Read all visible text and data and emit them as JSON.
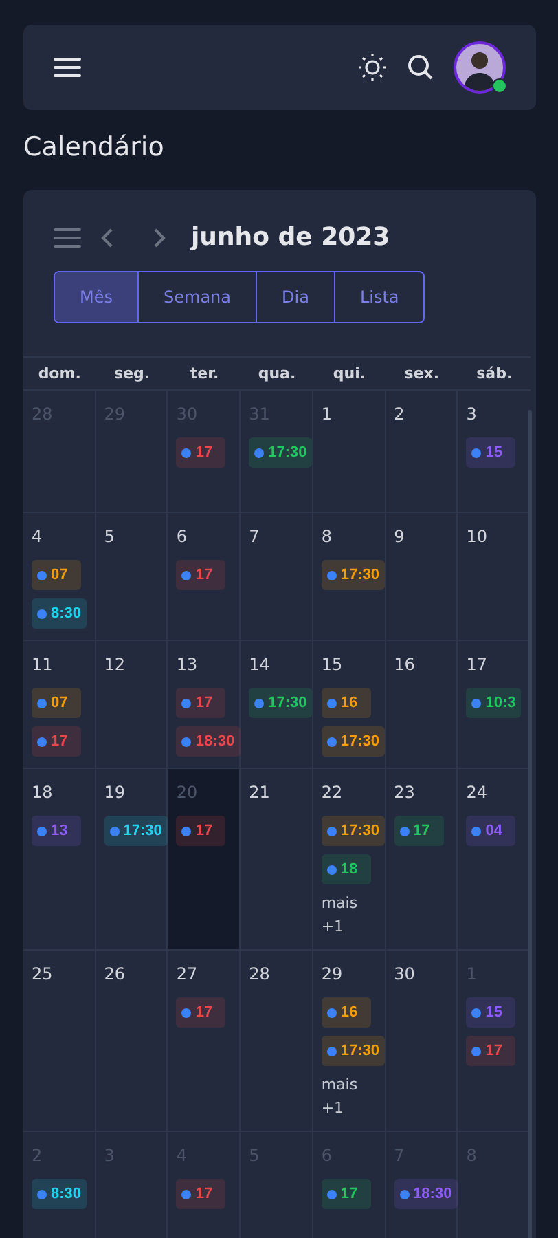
{
  "header": {
    "avatar": {
      "online": true
    }
  },
  "page_title": "Calendário",
  "calendar": {
    "title": "junho de 2023",
    "views": [
      {
        "label": "Mês",
        "selected": true
      },
      {
        "label": "Semana",
        "selected": false
      },
      {
        "label": "Dia",
        "selected": false
      },
      {
        "label": "Lista",
        "selected": false
      }
    ],
    "weekdays": [
      "dom.",
      "seg.",
      "ter.",
      "qua.",
      "qui.",
      "sex.",
      "sáb."
    ],
    "weeks": [
      {
        "days": [
          {
            "date": "28",
            "outside": true,
            "today": false
          },
          {
            "date": "29",
            "outside": true,
            "today": false
          },
          {
            "date": "30",
            "outside": true,
            "today": false,
            "events": [
              {
                "time": "17",
                "color": "#e5484d"
              }
            ]
          },
          {
            "date": "31",
            "outside": true,
            "today": false,
            "events": [
              {
                "time": "17:30",
                "color": "#22c55e"
              }
            ]
          },
          {
            "date": "1",
            "outside": false,
            "today": false
          },
          {
            "date": "2",
            "outside": false,
            "today": false
          },
          {
            "date": "3",
            "outside": false,
            "today": false,
            "events": [
              {
                "time": "15",
                "color": "#8b5cf6"
              }
            ]
          }
        ]
      },
      {
        "days": [
          {
            "date": "4",
            "outside": false,
            "today": false,
            "events": [
              {
                "time": "07",
                "color": "#f59e0b"
              },
              {
                "time": "8:30",
                "color": "#22d3ee"
              }
            ]
          },
          {
            "date": "5",
            "outside": false,
            "today": false
          },
          {
            "date": "6",
            "outside": false,
            "today": false,
            "events": [
              {
                "time": "17",
                "color": "#e5484d"
              }
            ]
          },
          {
            "date": "7",
            "outside": false,
            "today": false
          },
          {
            "date": "8",
            "outside": false,
            "today": false,
            "events": [
              {
                "time": "17:30",
                "color": "#f59e0b"
              }
            ]
          },
          {
            "date": "9",
            "outside": false,
            "today": false
          },
          {
            "date": "10",
            "outside": false,
            "today": false
          }
        ]
      },
      {
        "days": [
          {
            "date": "11",
            "outside": false,
            "today": false,
            "events": [
              {
                "time": "07",
                "color": "#f59e0b"
              },
              {
                "time": "17",
                "color": "#e5484d"
              }
            ]
          },
          {
            "date": "12",
            "outside": false,
            "today": false
          },
          {
            "date": "13",
            "outside": false,
            "today": false,
            "events": [
              {
                "time": "17",
                "color": "#e5484d"
              },
              {
                "time": "18:30",
                "color": "#e5484d"
              }
            ]
          },
          {
            "date": "14",
            "outside": false,
            "today": false,
            "events": [
              {
                "time": "17:30",
                "color": "#22c55e"
              }
            ]
          },
          {
            "date": "15",
            "outside": false,
            "today": false,
            "events": [
              {
                "time": "16",
                "color": "#f59e0b"
              },
              {
                "time": "17:30",
                "color": "#f59e0b"
              }
            ]
          },
          {
            "date": "16",
            "outside": false,
            "today": false
          },
          {
            "date": "17",
            "outside": false,
            "today": false,
            "events": [
              {
                "time": "10:3",
                "color": "#22c55e"
              }
            ]
          }
        ]
      },
      {
        "days": [
          {
            "date": "18",
            "outside": false,
            "today": false,
            "events": [
              {
                "time": "13",
                "color": "#8b5cf6"
              }
            ]
          },
          {
            "date": "19",
            "outside": false,
            "today": false,
            "events": [
              {
                "time": "17:30",
                "color": "#22d3ee"
              }
            ]
          },
          {
            "date": "20",
            "outside": false,
            "today": true,
            "events": [
              {
                "time": "17",
                "color": "#e5484d"
              }
            ]
          },
          {
            "date": "21",
            "outside": false,
            "today": false
          },
          {
            "date": "22",
            "outside": false,
            "today": false,
            "events": [
              {
                "time": "17:30",
                "color": "#f59e0b"
              },
              {
                "time": "18",
                "color": "#22c55e"
              }
            ],
            "more": "mais +1"
          },
          {
            "date": "23",
            "outside": false,
            "today": false,
            "events": [
              {
                "time": "17",
                "color": "#22c55e"
              }
            ]
          },
          {
            "date": "24",
            "outside": false,
            "today": false,
            "events": [
              {
                "time": "04",
                "color": "#8b5cf6"
              }
            ]
          }
        ]
      },
      {
        "days": [
          {
            "date": "25",
            "outside": false,
            "today": false
          },
          {
            "date": "26",
            "outside": false,
            "today": false
          },
          {
            "date": "27",
            "outside": false,
            "today": false,
            "events": [
              {
                "time": "17",
                "color": "#e5484d"
              }
            ]
          },
          {
            "date": "28",
            "outside": false,
            "today": false
          },
          {
            "date": "29",
            "outside": false,
            "today": false,
            "events": [
              {
                "time": "16",
                "color": "#f59e0b"
              },
              {
                "time": "17:30",
                "color": "#f59e0b"
              }
            ],
            "more": "mais +1"
          },
          {
            "date": "30",
            "outside": false,
            "today": false
          },
          {
            "date": "1",
            "outside": true,
            "today": false,
            "events": [
              {
                "time": "15",
                "color": "#8b5cf6"
              },
              {
                "time": "17",
                "color": "#e5484d"
              }
            ]
          }
        ]
      },
      {
        "days": [
          {
            "date": "2",
            "outside": true,
            "today": false,
            "events": [
              {
                "time": "8:30",
                "color": "#22d3ee"
              }
            ]
          },
          {
            "date": "3",
            "outside": true,
            "today": false
          },
          {
            "date": "4",
            "outside": true,
            "today": false,
            "events": [
              {
                "time": "17",
                "color": "#e5484d"
              }
            ]
          },
          {
            "date": "5",
            "outside": true,
            "today": false
          },
          {
            "date": "6",
            "outside": true,
            "today": false,
            "events": [
              {
                "time": "17",
                "color": "#22c55e"
              }
            ]
          },
          {
            "date": "7",
            "outside": true,
            "today": false,
            "events": [
              {
                "time": "18:30",
                "color": "#8b5cf6"
              }
            ]
          },
          {
            "date": "8",
            "outside": true,
            "today": false
          }
        ]
      }
    ]
  }
}
